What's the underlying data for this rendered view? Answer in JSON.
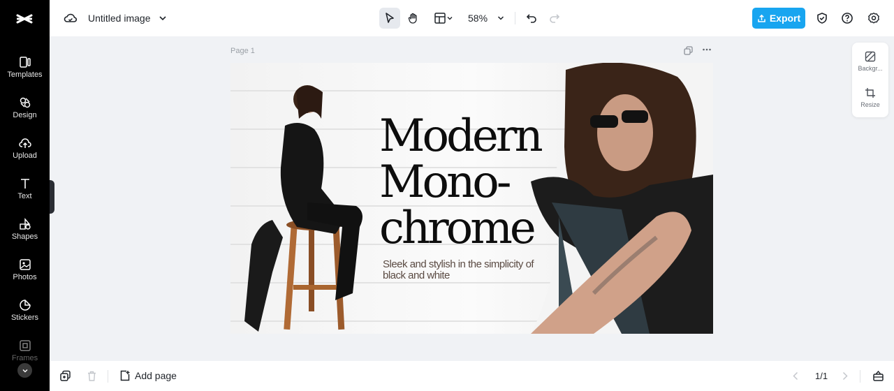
{
  "app": {
    "doc_title": "Untitled image",
    "zoom": "58%",
    "export_label": "Export"
  },
  "sidebar": {
    "items": [
      {
        "label": "Templates",
        "icon": "templates-icon"
      },
      {
        "label": "Design",
        "icon": "design-icon"
      },
      {
        "label": "Upload",
        "icon": "upload-icon"
      },
      {
        "label": "Text",
        "icon": "text-icon"
      },
      {
        "label": "Shapes",
        "icon": "shapes-icon"
      },
      {
        "label": "Photos",
        "icon": "photos-icon"
      },
      {
        "label": "Stickers",
        "icon": "stickers-icon"
      },
      {
        "label": "Frames",
        "icon": "frames-icon"
      }
    ]
  },
  "canvas": {
    "page_label": "Page 1",
    "headline": [
      "Modern",
      "Mono-",
      "chrome"
    ],
    "subline": "Sleek and stylish in the simplicity of black and white"
  },
  "right_panel": {
    "items": [
      {
        "label": "Backgr...",
        "icon": "background-icon"
      },
      {
        "label": "Resize",
        "icon": "resize-icon"
      }
    ]
  },
  "bottom": {
    "add_page": "Add page",
    "pager": "1/1"
  },
  "colors": {
    "accent": "#18a5f0",
    "rail_bg": "#000000",
    "canvas_bg": "#f0f2f5"
  }
}
